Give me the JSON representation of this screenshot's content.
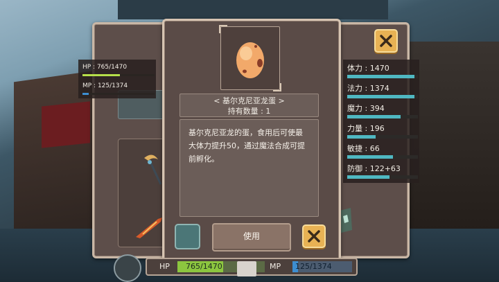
{
  "left_stats": {
    "hp_text": "HP : 765/1470",
    "hp_fraction": 0.52,
    "mp_text": "MP : 125/1374",
    "mp_fraction": 0.09
  },
  "item": {
    "name": "< 基尔克尼亚龙蛋 >",
    "count": "持有数量 : 1",
    "description": "基尔克尼亚龙的蛋，食用后可使最大体力提升50，通过魔法合成可提前孵化。",
    "use_label": "使用",
    "icon": "dragon-egg-icon"
  },
  "right_stats": [
    {
      "label": "体力 : 1470",
      "fraction": 0.95
    },
    {
      "label": "法力 : 1374",
      "fraction": 0.95
    },
    {
      "label": "魔力 : 394",
      "fraction": 0.75
    },
    {
      "label": "力量 : 196",
      "fraction": 0.4
    },
    {
      "label": "敏捷 : 66",
      "fraction": 0.65
    },
    {
      "label": "防御 : 122+63",
      "fraction": 0.6
    }
  ],
  "hud": {
    "hp_label": "HP",
    "hp_value": "765/1470",
    "mp_label": "MP",
    "mp_value": "125/1374",
    "hp_fraction": 0.52,
    "mp_fraction": 0.09
  },
  "colors": {
    "hp_bar": "#b6e04a",
    "mp_bar": "#3d8ed1",
    "stat_bar": "#4fb8c2",
    "close_button": "#e8b254"
  }
}
